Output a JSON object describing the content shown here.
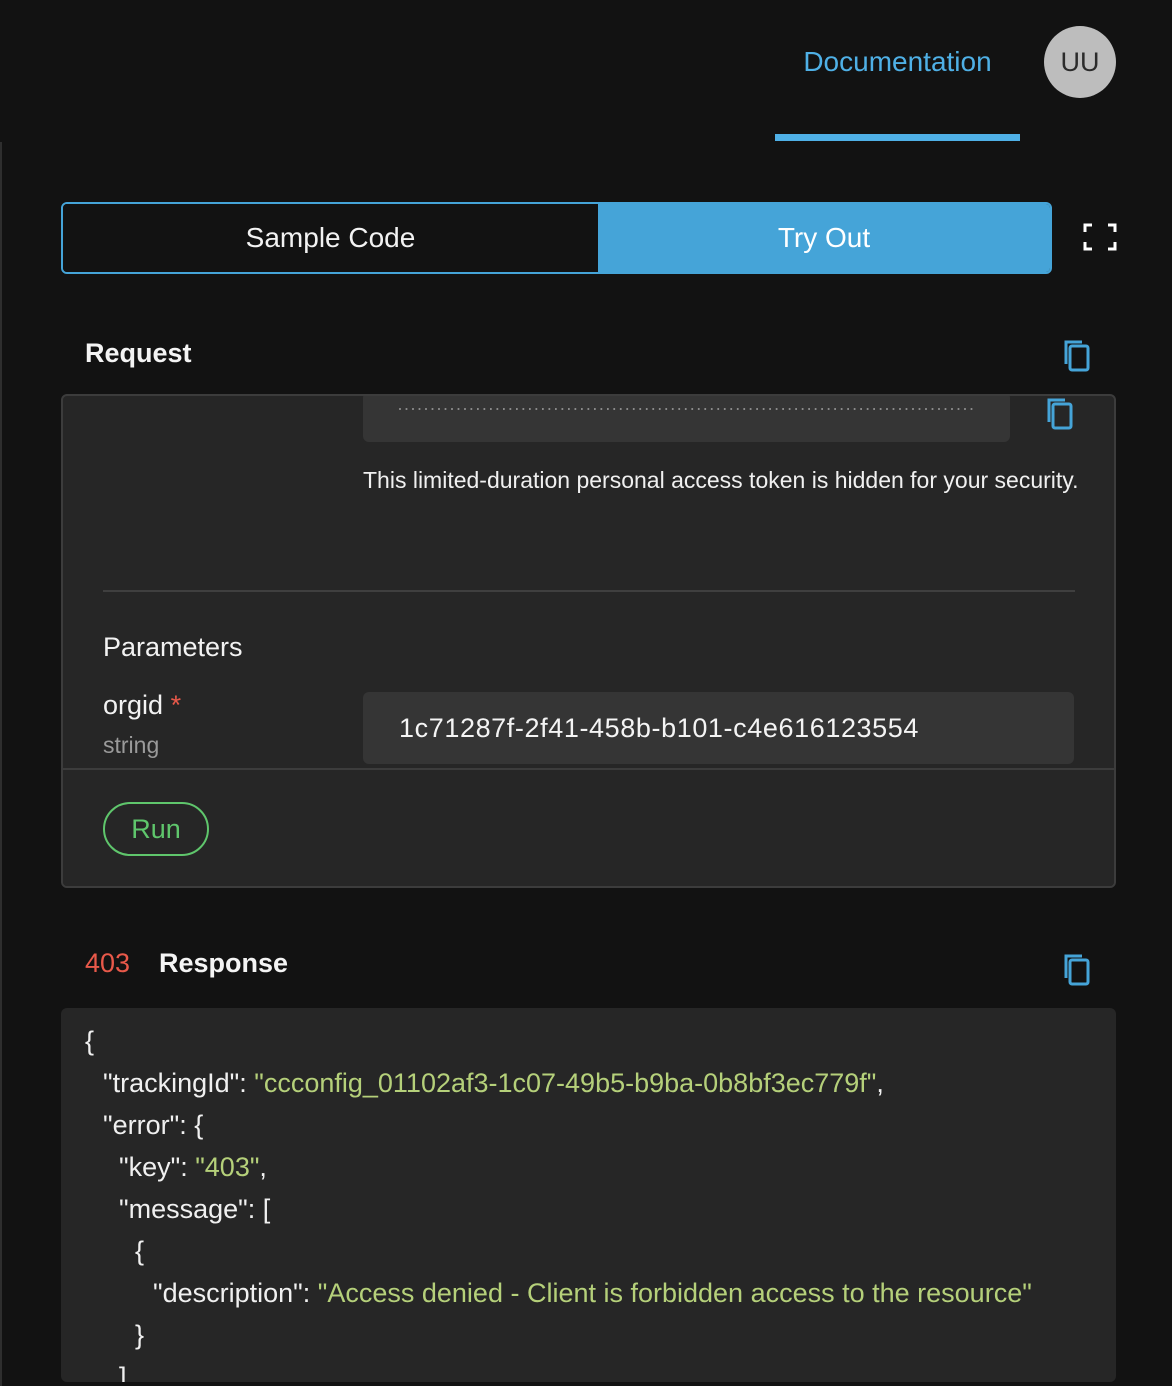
{
  "header": {
    "nav_tab": "Documentation",
    "avatar_initials": "UU",
    "accent_color": "#4fb0e6"
  },
  "mode_toggle": {
    "sample_code": "Sample Code",
    "try_out": "Try Out",
    "active": "Try Out"
  },
  "request": {
    "title": "Request",
    "token_masked": "···························································································",
    "token_note": "This limited-duration personal access token is hidden for your security.",
    "parameters_title": "Parameters",
    "param": {
      "name": "orgid",
      "required_marker": "*",
      "type": "string",
      "value": "1c71287f-2f41-458b-b101-c4e616123554"
    },
    "run_label": "Run"
  },
  "response": {
    "status_code": "403",
    "title": "Response",
    "lines": {
      "l1": "{",
      "l2_key": "\"trackingId\"",
      "l2_value": "\"ccconfig_01102af3-1c07-49b5-b9ba-0b8bf3ec779f\"",
      "l3_key": "\"error\"",
      "l3_rest": ": {",
      "l4_key": "\"key\"",
      "l4_value": "\"403\"",
      "l5_key": "\"message\"",
      "l5_rest": ": [",
      "l6": "{",
      "l7_key": "\"description\"",
      "l7_value": "\"Access denied - Client is forbidden access to the resource\"",
      "l8": "}",
      "l9": "]"
    }
  }
}
